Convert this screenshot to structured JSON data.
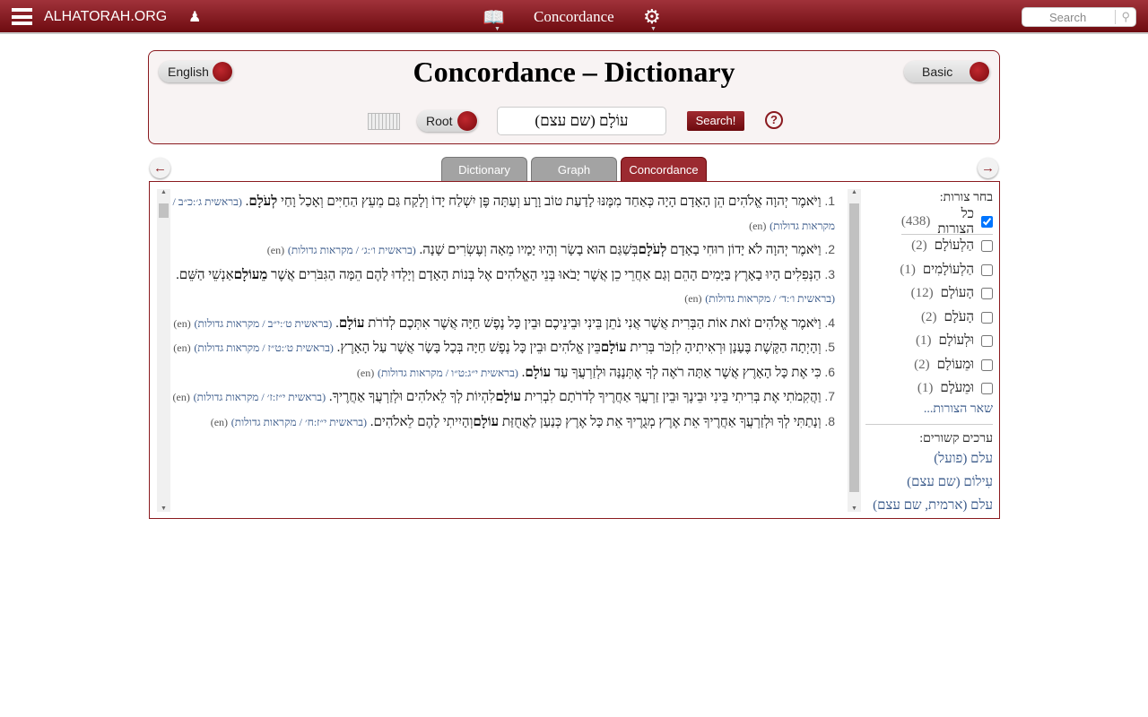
{
  "topbar": {
    "site": "ALHATORAH.ORG",
    "title": "Concordance",
    "search_placeholder": "Search"
  },
  "panel": {
    "title": "Concordance – Dictionary",
    "language_toggle": "English",
    "mode_toggle": "Basic",
    "root_toggle": "Root",
    "query": "עוֹלָם  (שם עצם)",
    "search_button": "Search!",
    "help": "?"
  },
  "tabs": [
    {
      "label": "Dictionary",
      "active": false
    },
    {
      "label": "Graph",
      "active": false
    },
    {
      "label": "Concordance",
      "active": true
    }
  ],
  "colors": {
    "brand": "#8a1a1f",
    "link": "#3a5a8a"
  },
  "verses": [
    {
      "num": "1.",
      "pre": "וַיֹּאמֶר יְהוָה אֱלֹהִים הֵן הָאָדָם הָיָה כְּאַחַד מִמֶּנּוּ לָדַעַת טוֹב וָרָע וְעַתָּה פֶּן יִשְׁלַח יָדוֹ וְלָקַח גַּם מֵעֵץ הַחַיִּים וְאָכַל וָחַי",
      "word": "לְעֹלָם",
      "post": ".",
      "ref": "(בראשית ג׳:כ״ב",
      "mg": "מקראות גדולות)",
      "en": "(en)"
    },
    {
      "num": "2.",
      "pre": "וַיֹּאמֶר יְהוָה לֹא יָדוֹן רוּחִי בָאָדָם",
      "word": "לְעֹלָם",
      "post": "בְּשַׁגַּם הוּא בָשָׂר וְהָיוּ יָמָיו מֵאָה וְעֶשְׂרִים שָׁנָה.",
      "ref": "(בראשית ו׳:ג׳",
      "mg": "מקראות גדולות)",
      "en": "(en)"
    },
    {
      "num": "3.",
      "pre": "הַנְּפִלִים הָיוּ בָאָרֶץ בַּיָּמִים הָהֵם וְגַם אַחֲרֵי כֵן אֲשֶׁר יָבֹאוּ בְּנֵי הָאֱלֹהִים אֶל בְּנוֹת הָאָדָם וְיָלְדוּ לָהֶם הֵמָּה הַגִּבֹּרִים אֲשֶׁר",
      "word": "מֵעוֹלָם",
      "post": "אַנְשֵׁי הַשֵּׁם.",
      "ref": "(בראשית ו׳:ד׳",
      "mg": "מקראות גדולות)",
      "en": "(en)"
    },
    {
      "num": "4.",
      "pre": "וַיֹּאמֶר אֱלֹהִים זֹאת אוֹת הַבְּרִית אֲשֶׁר אֲנִי נֹתֵן בֵּינִי וּבֵינֵיכֶם וּבֵין כָּל נֶפֶשׁ חַיָּה אֲשֶׁר אִתְּכֶם לְדֹרֹת",
      "word": "עוֹלָם",
      "post": ".",
      "ref": "(בראשית ט׳:י״ב",
      "mg": "מקראות גדולות)",
      "en": "(en)"
    },
    {
      "num": "5.",
      "pre": "וְהָיְתָה הַקֶּשֶׁת בֶּעָנָן וּרְאִיתִיהָ לִזְכֹּר בְּרִית",
      "word": "עוֹלָם",
      "post": "בֵּין אֱלֹהִים וּבֵין כָּל נֶפֶשׁ חַיָּה בְּכָל בָּשָׂר אֲשֶׁר עַל הָאָרֶץ.",
      "ref": "(בראשית ט׳:ט״ז",
      "mg": "מקראות גדולות)",
      "en": "(en)"
    },
    {
      "num": "6.",
      "pre": "כִּי אֶת כָּל הָאָרֶץ אֲשֶׁר אַתָּה רֹאֶה לְךָ אֶתְּנֶנָּה וּלְזַרְעֲךָ עַד",
      "word": "עוֹלָם",
      "post": ".",
      "ref": "(בראשית י״ג:ט״ו",
      "mg": "מקראות גדולות)",
      "en": "(en)"
    },
    {
      "num": "7.",
      "pre": "וַהֲקִמֹתִי אֶת בְּרִיתִי בֵּינִי וּבֵינֶךָ וּבֵין זַרְעֲךָ אַחֲרֶיךָ לְדֹרֹתָם לִבְרִית",
      "word": "עוֹלָם",
      "post": "לִהְיוֹת לְךָ לֵאלֹהִים וּלְזַרְעֲךָ אַחֲרֶיךָ.",
      "ref": "(בראשית י״ז:ז׳",
      "mg": "מקראות גדולות)",
      "en": "(en)"
    },
    {
      "num": "8.",
      "pre": "וְנָתַתִּי לְךָ וּלְזַרְעֲךָ אַחֲרֶיךָ אֵת אֶרֶץ מְגֻרֶיךָ אֵת כָּל אֶרֶץ כְּנַעַן לַאֲחֻזַּת",
      "word": "עוֹלָם",
      "post": "וְהָיִיתִי לָהֶם לֵאלֹהִים.",
      "ref": "(בראשית י״ז:ח׳",
      "mg": "מקראות גדולות)",
      "en": "(en)"
    }
  ],
  "sidebar": {
    "forms_heading": "בחר צורות:",
    "all": {
      "label": "כל הצורות",
      "count": "(438)",
      "checked": true
    },
    "forms": [
      {
        "label": "הַלְעוֹלָם",
        "count": "(2)"
      },
      {
        "label": "הַלְעוֹלָמִים",
        "count": "(1)"
      },
      {
        "label": "הָעוֹלָם",
        "count": "(12)"
      },
      {
        "label": "הָעֹלָם",
        "count": "(2)"
      },
      {
        "label": "וּלְעוֹלָם",
        "count": "(1)"
      },
      {
        "label": "וּמֵעוֹלָם",
        "count": "(2)"
      },
      {
        "label": "וּמֵעֹלָם",
        "count": "(1)"
      }
    ],
    "more_forms": "שאר הצורות...",
    "related_heading": "ערכים קשורים:",
    "related": [
      "עלם (פועל)",
      "עִילוֹם (שם עצם)",
      "עלם (ארמית, שם עצם)"
    ]
  }
}
